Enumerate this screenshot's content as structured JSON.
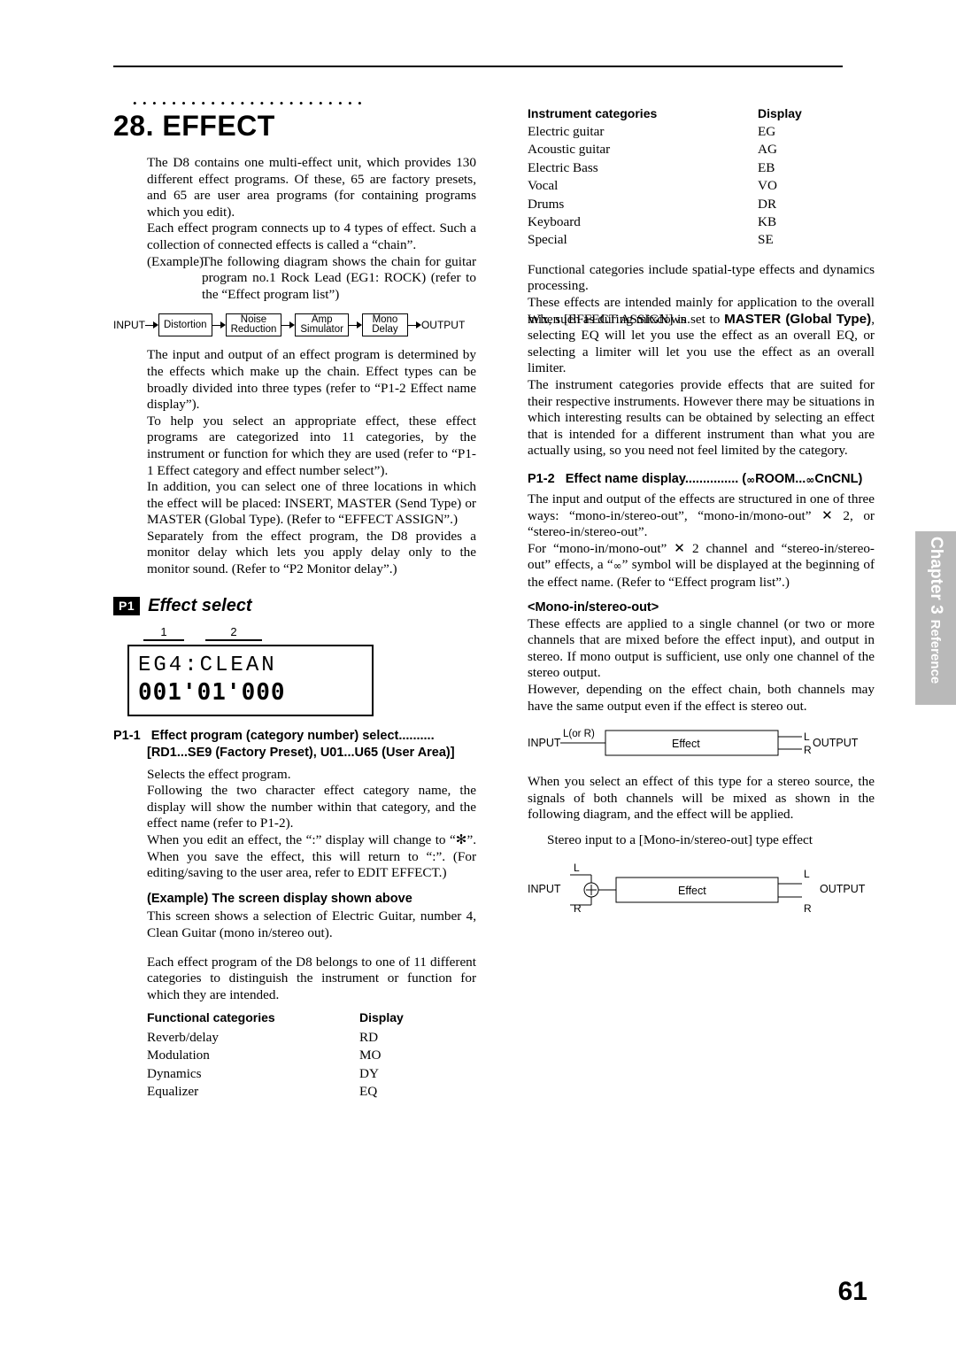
{
  "page": {
    "number": "61"
  },
  "chapter_tab": {
    "line1": "Chapter 3",
    "line2": "Reference"
  },
  "left": {
    "dots": "••••••••••••••••••••••••",
    "title": "28. EFFECT",
    "p1": "The D8 contains one multi-effect unit, which provides 130 different effect programs. Of these, 65 are factory presets, and 65 are user area programs (for containing programs which you edit).",
    "p2": "Each effect program connects up to 4 types of effect. Such a collection of connected effects is called a “chain”.",
    "p3_label": "(Example)",
    "p3": "The following diagram shows the chain for guitar program no.1 Rock Lead (EG1: ROCK) (refer to the “Effect program list”)",
    "chain": {
      "input": "INPUT",
      "blocks": [
        "Distortion",
        "Noise\nReduction",
        "Amp\nSimulator",
        "Mono\nDelay"
      ],
      "output": "OUTPUT"
    },
    "p4": "The input and output of an effect program is determined by the effects which make up the chain. Effect types can be broadly divided into three types (refer to “P1-2 Effect name display”).",
    "p5": "To help you select an appropriate effect, these effect programs are categorized into 11 categories, by the instrument or function for which they are used (refer to “P1-1 Effect category and effect number select”).",
    "p6": "In addition, you can select one of three locations in which the effect will be placed: INSERT, MASTER (Send Type) or MASTER (Global Type). (Refer to “EFFECT ASSIGN”.)",
    "p7": "Separately from the effect program, the D8 provides a monitor delay which lets you apply delay only to the monitor sound. (Refer to “P2 Monitor delay”.)",
    "p1_badge": "P1",
    "p1_title": "Effect select",
    "lcd": {
      "mark1": "1",
      "mark2": "2",
      "line1": "EG4:CLEAN",
      "line2": "001'01'000"
    },
    "p11_label": "P1-1",
    "p11_title": "Effect program (category number) select..........",
    "p11_sub": "[RD1...SE9 (Factory Preset), U01...U65 (User Area)]",
    "p8": "Selects the effect program.",
    "p9": "Following the two character effect category name, the display will show the number within that category, and the effect name (refer to P1-2).",
    "p10": "When you edit an effect, the “:” display will change to “✻”. When you save the effect, this will return to “:”. (For editing/saving to the user area, refer to EDIT EFFECT.)",
    "example_head": "(Example) The screen display shown above",
    "p11": "This screen shows a selection of Electric Guitar, number 4, Clean Guitar (mono in/stereo out).",
    "p12": "Each effect program of the D8 belongs to one of 11 different categories to distinguish the instrument or function for which they are intended.",
    "table": {
      "headers": [
        "Functional categories",
        "Display"
      ],
      "rows": [
        [
          "Reverb/delay",
          "RD"
        ],
        [
          "Modulation",
          "MO"
        ],
        [
          "Dynamics",
          "DY"
        ],
        [
          "Equalizer",
          "EQ"
        ]
      ]
    }
  },
  "right": {
    "table": {
      "headers": [
        "Instrument categories",
        "Display"
      ],
      "rows": [
        [
          "Electric guitar",
          "EG"
        ],
        [
          "Acoustic guitar",
          "AG"
        ],
        [
          "Electric Bass",
          "EB"
        ],
        [
          "Vocal",
          "VO"
        ],
        [
          "Drums",
          "DR"
        ],
        [
          "Keyboard",
          "KB"
        ],
        [
          "Special",
          "SE"
        ]
      ]
    },
    "p1": "Functional categories include spatial-type effects and dynamics processing.",
    "p2": "These effects are intended mainly for application to the overall mix, such as during mixdown.",
    "p3": "When [EFFECT ASSIGN] is set to MASTER (Global Type), selecting EQ will let you use the effect as an overall EQ, or selecting a limiter will let you use the effect as an overall limiter.",
    "p4": "The instrument categories provide effects that are suited for their respective instruments. However there may be situations in which interesting results can be obtained by selecting an effect that is intended for a different instrument than what you are actually using, so you need not feel limited by the category.",
    "p12_label": "P1-2",
    "p12_title": "Effect name display...............",
    "p12_title2": "ROOM...",
    "p12_title3": "CnCNL)",
    "p5": "The input and output of the effects are structured in one of three ways: “mono-in/stereo-out”, “mono-in/mono-out” ✕ 2, or “stereo-in/stereo-out”.",
    "p6": "For “mono-in/mono-out” ✕ 2 channel and “stereo-in/stereo-out” effects, a “      ” symbol will be displayed at the beginning of the effect name. (Refer to “Effect program list”.)",
    "mono_head": "<Mono-in/stereo-out>",
    "p7": "These effects are applied to a single channel (or two or more channels that are mixed before the effect input), and output in stereo. If mono output is sufficient, use only one channel of the stereo output.",
    "p8": "However, depending on the effect chain, both channels may have the same output even if the effect is stereo out.",
    "diag1": {
      "input": "INPUT",
      "in_label": "L(or R)",
      "effect": "Effect",
      "out_l": "L",
      "out_r": "R",
      "output": "OUTPUT"
    },
    "p9": "When you select an effect of this type for a stereo source, the signals of both channels will be mixed as shown in the following diagram, and the effect will be applied.",
    "p10": "Stereo input to a [Mono-in/stereo-out] type effect",
    "diag2": {
      "input": "INPUT",
      "in_l": "L",
      "in_r": "R",
      "effect": "Effect",
      "out_l": "L",
      "out_r": "R",
      "output": "OUTPUT"
    }
  }
}
